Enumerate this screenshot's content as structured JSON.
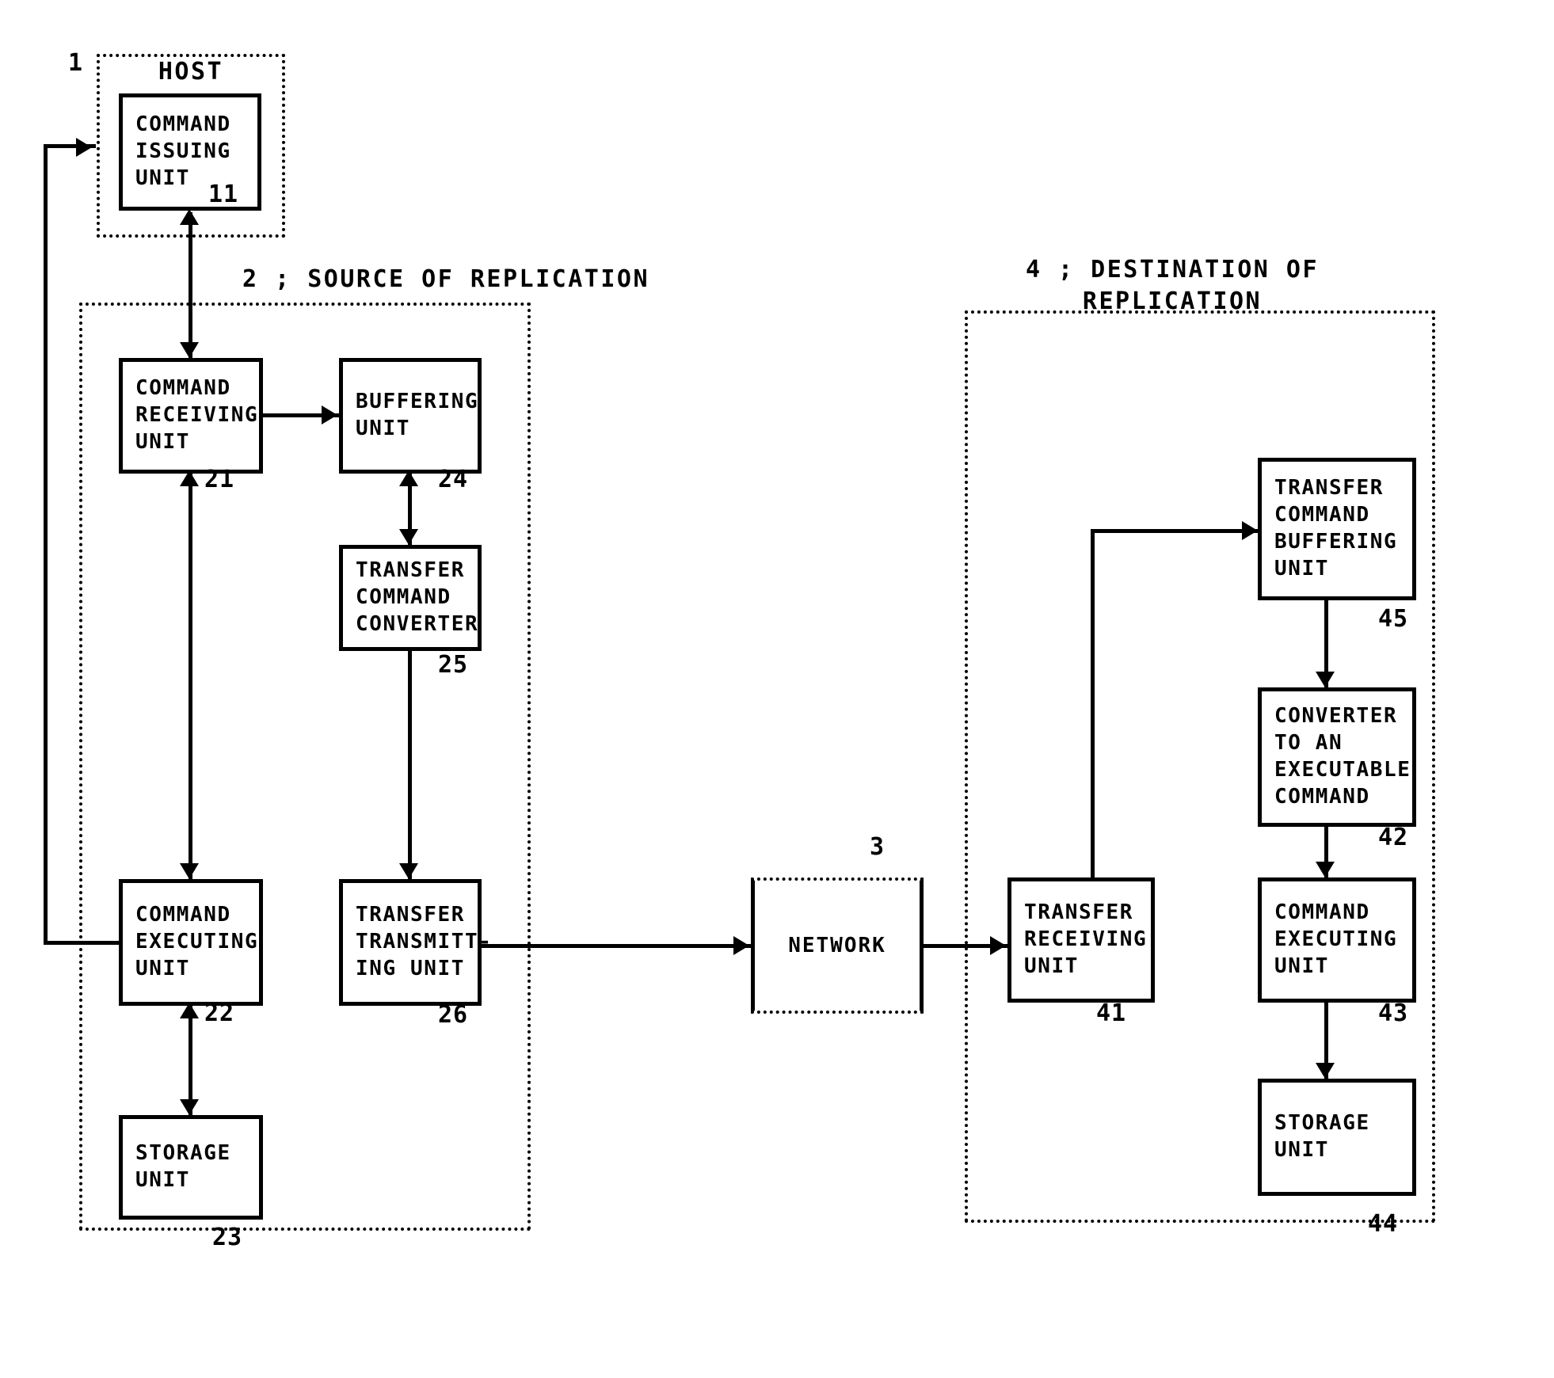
{
  "figure": {
    "title": "Replication system block diagram",
    "enclosures": [
      {
        "id": "host",
        "numeral": "1",
        "label": "HOST"
      },
      {
        "id": "source",
        "numeral": "2",
        "caption": "2 ; SOURCE OF REPLICATION"
      },
      {
        "id": "destination",
        "numeral": "4",
        "caption_line1": "4 ; DESTINATION OF",
        "caption_line2": "REPLICATION"
      }
    ],
    "blocks": [
      {
        "id": "command-issuing-unit",
        "lines": [
          "COMMAND",
          "ISSUING",
          "UNIT"
        ],
        "numeral": "11"
      },
      {
        "id": "command-receiving-unit",
        "lines": [
          "COMMAND",
          "RECEIVING",
          "UNIT"
        ],
        "numeral": "21"
      },
      {
        "id": "buffering-unit",
        "lines": [
          "BUFFERING",
          "UNIT"
        ],
        "numeral": "24"
      },
      {
        "id": "transfer-command-converter",
        "lines": [
          "TRANSFER",
          "COMMAND",
          "CONVERTER"
        ],
        "numeral": "25"
      },
      {
        "id": "command-executing-unit-source",
        "lines": [
          "COMMAND",
          "EXECUTING",
          "UNIT"
        ],
        "numeral": "22"
      },
      {
        "id": "transfer-transmitting-unit",
        "lines": [
          "TRANSFER",
          "TRANSMITT-",
          "ING UNIT"
        ],
        "numeral": "26"
      },
      {
        "id": "storage-unit-source",
        "lines": [
          "STORAGE",
          "UNIT"
        ],
        "numeral": "23"
      },
      {
        "id": "network",
        "lines": [
          "NETWORK"
        ],
        "numeral": "3"
      },
      {
        "id": "transfer-receiving-unit",
        "lines": [
          "TRANSFER",
          "RECEIVING",
          "UNIT"
        ],
        "numeral": "41"
      },
      {
        "id": "transfer-command-buffering-unit",
        "lines": [
          "TRANSFER",
          "COMMAND",
          "BUFFERING",
          "UNIT"
        ],
        "numeral": "45"
      },
      {
        "id": "converter-to-executable",
        "lines": [
          "CONVERTER",
          "TO AN",
          "EXECUTABLE",
          "COMMAND"
        ],
        "numeral": "42"
      },
      {
        "id": "command-executing-unit-dest",
        "lines": [
          "COMMAND",
          "EXECUTING",
          "UNIT"
        ],
        "numeral": "43"
      },
      {
        "id": "storage-unit-dest",
        "lines": [
          "STORAGE",
          "UNIT"
        ],
        "numeral": "44"
      }
    ],
    "text": {
      "host_label": "HOST",
      "num_1": "1",
      "num_3": "3",
      "num_11": "11",
      "num_21": "21",
      "num_22": "22",
      "num_23": "23",
      "num_24": "24",
      "num_25": "25",
      "num_26": "26",
      "num_41": "41",
      "num_42": "42",
      "num_43": "43",
      "num_44": "44",
      "num_45": "45",
      "source_caption": "2 ; SOURCE OF REPLICATION",
      "dest_caption_1": "4 ; DESTINATION OF",
      "dest_caption_2": "REPLICATION",
      "command_issuing_unit": "COMMAND\nISSUING\nUNIT",
      "command_receiving_unit": "COMMAND\nRECEIVING\nUNIT",
      "buffering_unit": "BUFFERING\nUNIT",
      "transfer_command_converter": "TRANSFER\nCOMMAND\nCONVERTER",
      "command_executing_unit_source": "COMMAND\nEXECUTING\nUNIT",
      "transfer_transmitting_unit": "TRANSFER\nTRANSMITT-\nING UNIT",
      "storage_unit_source": "STORAGE\nUNIT",
      "network": "NETWORK",
      "transfer_receiving_unit": "TRANSFER\nRECEIVING\nUNIT",
      "transfer_command_buffering_unit": "TRANSFER\nCOMMAND\nBUFFERING\nUNIT",
      "converter_to_executable": "CONVERTER\nTO AN\nEXECUTABLE\nCOMMAND",
      "command_executing_unit_dest": "COMMAND\nEXECUTING\nUNIT",
      "storage_unit_dest": "STORAGE\nUNIT"
    },
    "colors": {
      "ink": "#000000",
      "paper": "#ffffff"
    }
  }
}
